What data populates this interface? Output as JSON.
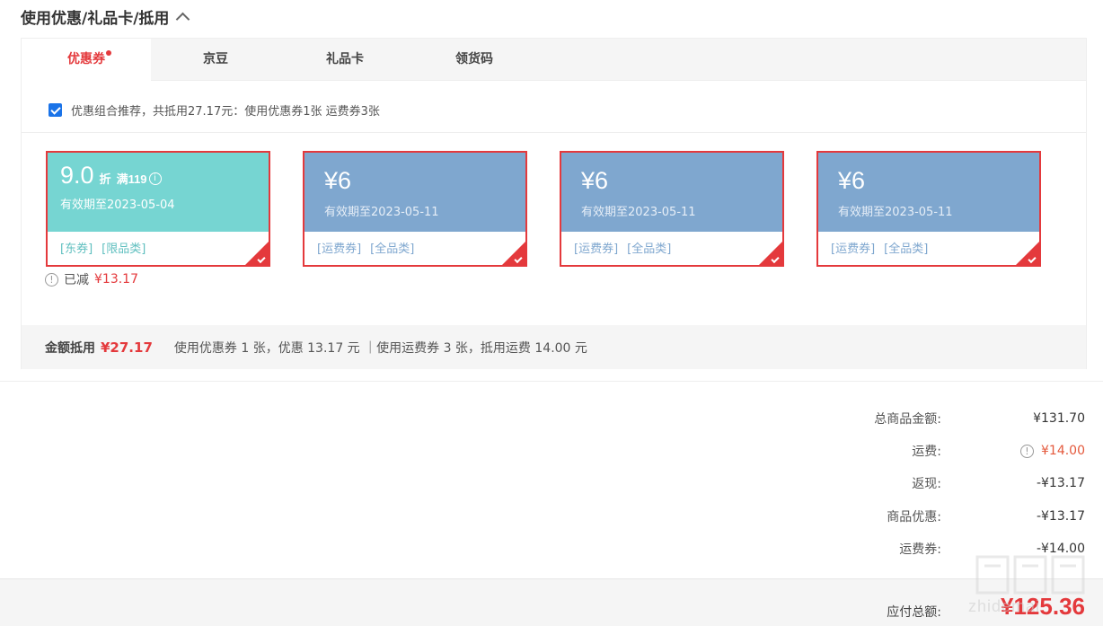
{
  "section": {
    "title": "使用优惠/礼品卡/抵用"
  },
  "tabs": [
    {
      "label": "优惠券",
      "active": true,
      "has_dot": true
    },
    {
      "label": "京豆"
    },
    {
      "label": "礼品卡"
    },
    {
      "label": "领货码"
    }
  ],
  "recommend": {
    "checked": true,
    "text": "优惠组合推荐，共抵用27.17元：使用优惠券1张 运费券3张"
  },
  "coupons": [
    {
      "value": "9.0",
      "unit": "折",
      "condition": "满119",
      "expiry": "有效期至2023-05-04",
      "tags": [
        "[东券]",
        "[限品类]"
      ],
      "color": "#76d5d2",
      "selected": true
    },
    {
      "value": "¥6",
      "expiry": "有效期至2023-05-11",
      "tags": [
        "[运费券]",
        "[全品类]"
      ],
      "color": "#7fa7cf",
      "selected": true
    },
    {
      "value": "¥6",
      "expiry": "有效期至2023-05-11",
      "tags": [
        "[运费券]",
        "[全品类]"
      ],
      "color": "#7fa7cf",
      "selected": true
    },
    {
      "value": "¥6",
      "expiry": "有效期至2023-05-11",
      "tags": [
        "[运费券]",
        "[全品类]"
      ],
      "color": "#7fa7cf",
      "selected": true
    }
  ],
  "used_note": {
    "label": "已减",
    "amount": "¥13.17"
  },
  "summary": {
    "label": "金额抵用",
    "amount": "¥27.17",
    "detail": "使用优惠券 1 张，优惠 13.17 元 ｜使用运费券 3 张，抵用运费 14.00 元"
  },
  "totals": [
    {
      "label": "总商品金额:",
      "value": "¥131.70"
    },
    {
      "label": "运费:",
      "value": "¥14.00",
      "has_info_icon": true
    },
    {
      "label": "返现:",
      "value": "-¥13.17"
    },
    {
      "label": "商品优惠:",
      "value": "-¥13.17"
    },
    {
      "label": "运费券:",
      "value": "-¥14.00"
    }
  ],
  "payable": {
    "label": "应付总额:",
    "value": "¥125.36"
  },
  "watermark": {
    "text": "zhidemai"
  },
  "colors": {
    "accent": "#e4393c",
    "coupon_teal": "#76d5d2",
    "coupon_blue": "#7fa7cf",
    "freight_orange": "#e4593c"
  }
}
